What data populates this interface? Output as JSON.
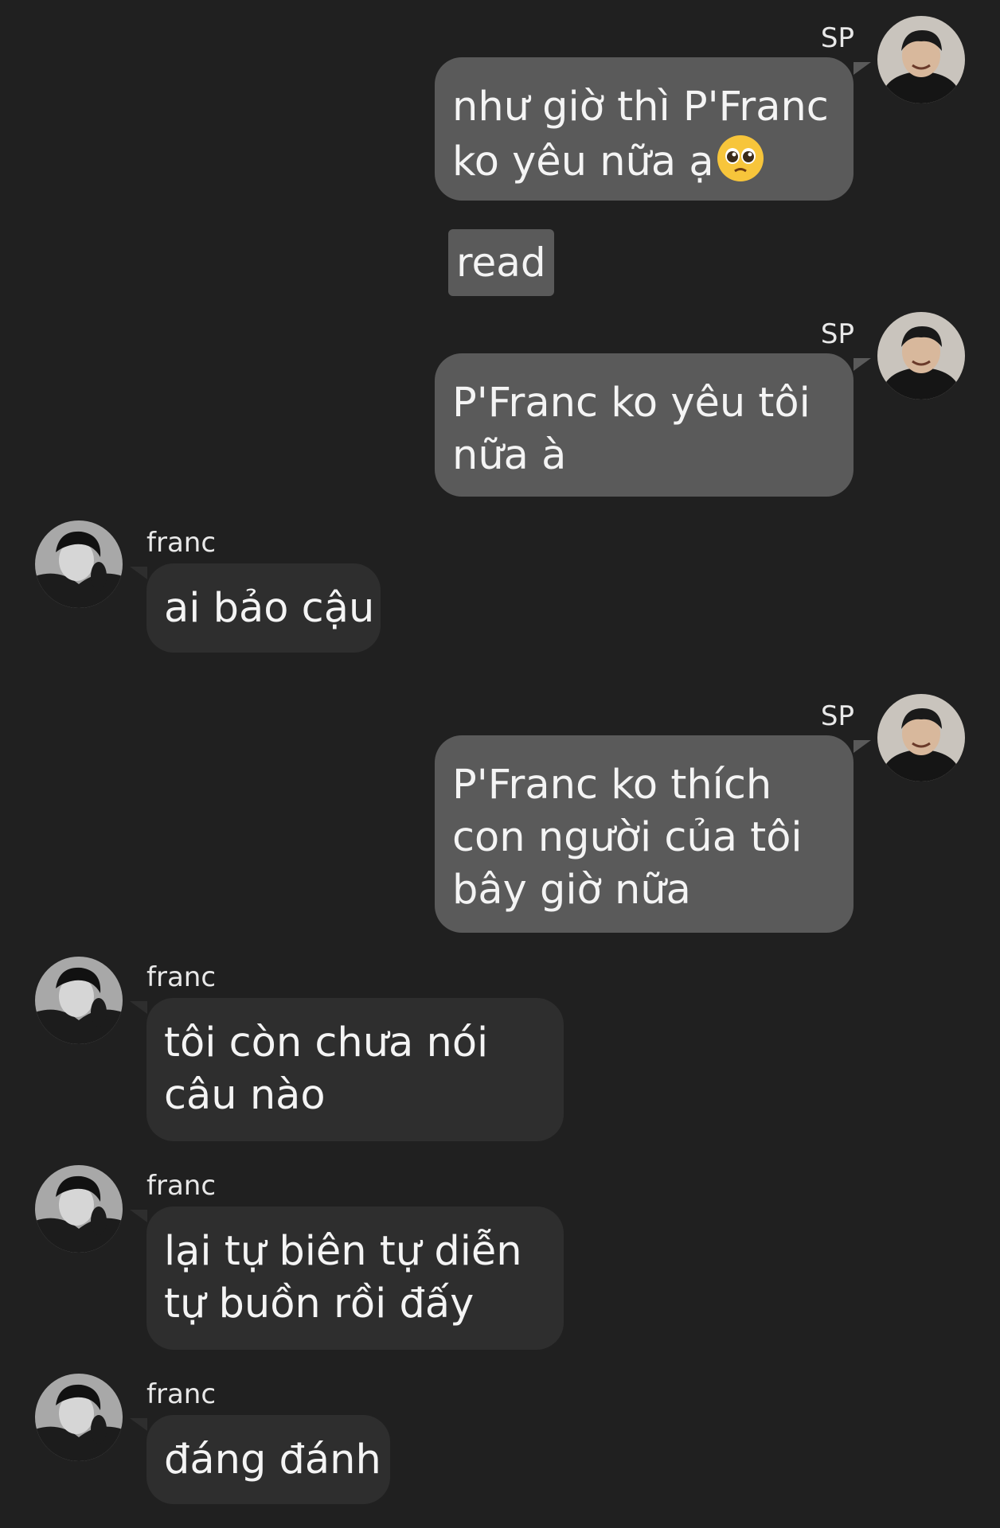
{
  "thread": {
    "msg1": {
      "sender": "SP",
      "line1": "như giờ thì P'Franc",
      "line2": "ko yêu nữa ạ",
      "emoji": "pleading-face-icon"
    },
    "read_label": "read",
    "msg2": {
      "sender": "SP",
      "line1": "P'Franc ko yêu tôi",
      "line2": "nữa à"
    },
    "msg3": {
      "sender": "franc",
      "line1": "ai bảo cậu"
    },
    "msg4": {
      "sender": "SP",
      "line1": "P'Franc ko thích",
      "line2": "con người của tôi",
      "line3": "bây giờ nữa"
    },
    "msg5": {
      "sender": "franc",
      "line1": "tôi còn chưa nói",
      "line2": "câu nào"
    },
    "msg6": {
      "sender": "franc",
      "line1": "lại tự biên tự diễn",
      "line2": "tự buồn rồi đấy"
    },
    "msg7": {
      "sender": "franc",
      "line1": "đáng đánh"
    }
  },
  "colors": {
    "background": "#202020",
    "sent_bubble": "#5a5a5a",
    "received_bubble": "#2e2e2e",
    "text": "#f4f4f4"
  }
}
